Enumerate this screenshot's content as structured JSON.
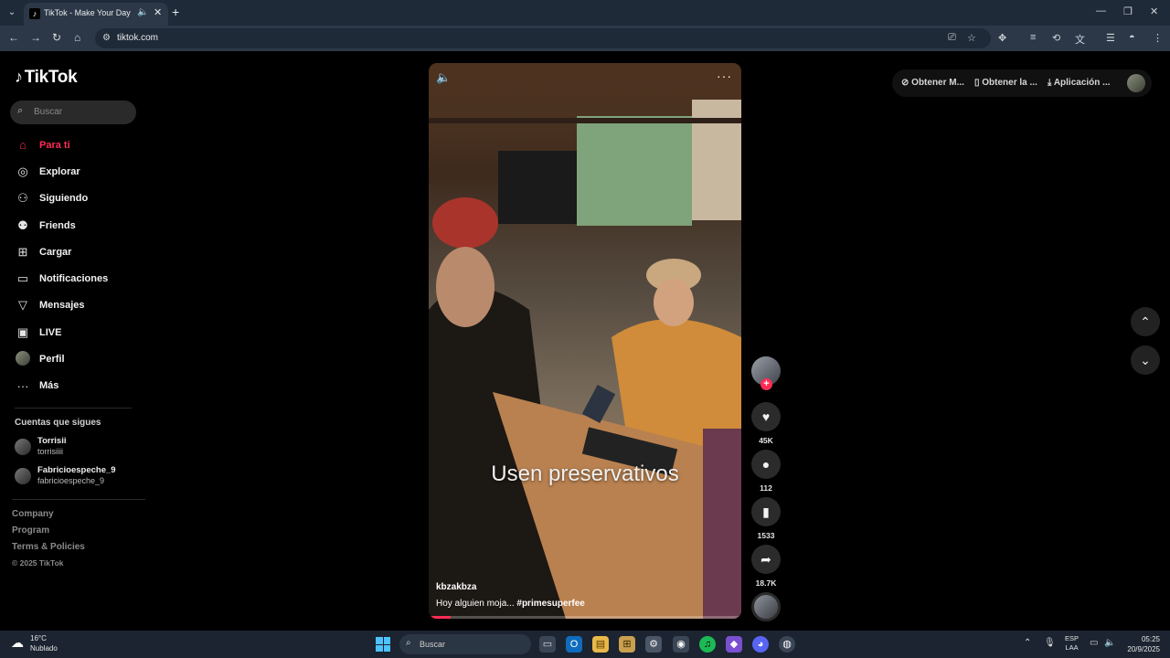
{
  "browser": {
    "tab_title": "TikTok - Make Your Day",
    "url": "tiktok.com"
  },
  "sidebar": {
    "logo": "TikTok",
    "search_placeholder": "Buscar",
    "nav": [
      {
        "label": "Para ti",
        "icon": "home-icon",
        "active": true
      },
      {
        "label": "Explorar",
        "icon": "compass-icon"
      },
      {
        "label": "Siguiendo",
        "icon": "following-icon"
      },
      {
        "label": "Friends",
        "icon": "friends-icon"
      },
      {
        "label": "Cargar",
        "icon": "upload-icon"
      },
      {
        "label": "Notificaciones",
        "icon": "notifications-icon"
      },
      {
        "label": "Mensajes",
        "icon": "messages-icon"
      },
      {
        "label": "LIVE",
        "icon": "live-icon"
      },
      {
        "label": "Perfil",
        "icon": "profile-avatar"
      },
      {
        "label": "Más",
        "icon": "more-icon"
      }
    ],
    "following_title": "Cuentas que sigues",
    "following": [
      {
        "name": "Torrisii",
        "username": "torrisiiii"
      },
      {
        "name": "Fabricioespeche_9",
        "username": "fabricioespeche_9"
      }
    ],
    "footer": {
      "company": "Company",
      "program": "Program",
      "terms": "Terms & Policies",
      "copyright": "© 2025 TikTok"
    }
  },
  "video": {
    "caption": "Usen preservativos",
    "author": "kbzakbza",
    "description": "Hoy alguien moja...",
    "hashtag": "#primesuperfee",
    "progress": 0.07
  },
  "actions": {
    "likes": "45K",
    "comments": "112",
    "saves": "1533",
    "shares": "18.7K"
  },
  "topbar": {
    "btn1": "Obtener M...",
    "btn2": "Obtener la ...",
    "btn3": "Aplicación ..."
  },
  "taskbar": {
    "temp": "16°C",
    "weather": "Nublado",
    "search_placeholder": "Buscar",
    "lang1": "ESP",
    "lang2": "LAA",
    "time": "05:25",
    "date": "20/9/2025"
  },
  "colors": {
    "accent": "#fe2c55",
    "chrome": "#2c3847"
  }
}
